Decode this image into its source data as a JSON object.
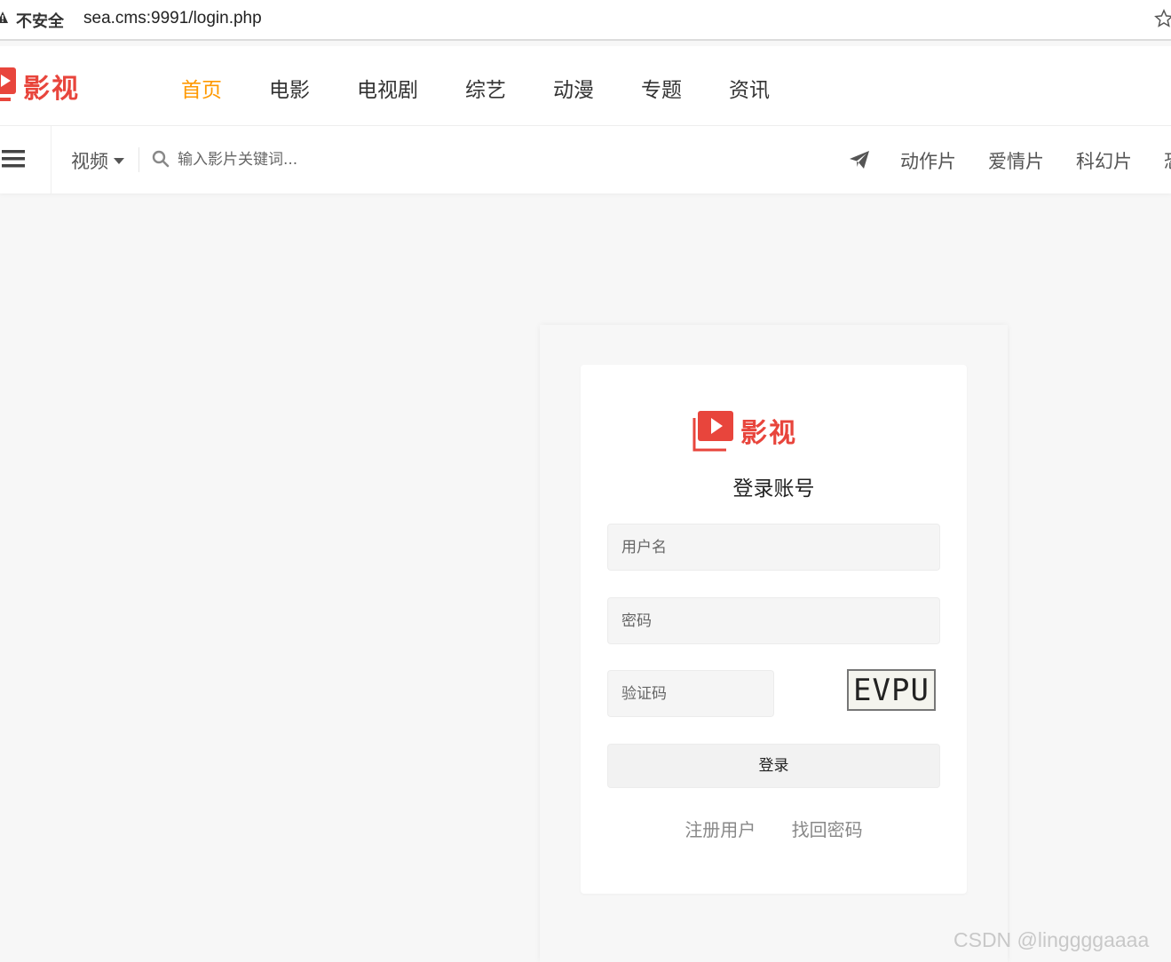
{
  "browser": {
    "security_label": "不安全",
    "url": "sea.cms:9991/login.php"
  },
  "site": {
    "logo_text": "影视",
    "brand_color": "#e8453c",
    "accent_color": "#ff9900",
    "nav": [
      "首页",
      "电影",
      "电视剧",
      "综艺",
      "动漫",
      "专题",
      "资讯"
    ],
    "active_nav": "首页"
  },
  "subbar": {
    "category": "视频",
    "search_placeholder": "输入影片关键词...",
    "genres": [
      "动作片",
      "爱情片",
      "科幻片",
      "恐"
    ]
  },
  "login": {
    "logo_text": "影视",
    "title": "登录账号",
    "username_placeholder": "用户名",
    "password_placeholder": "密码",
    "captcha_placeholder": "验证码",
    "captcha_code": "EVPU",
    "submit_label": "登录",
    "register_link": "注册用户",
    "recover_link": "找回密码"
  },
  "watermark": "CSDN @linggggaaaa"
}
